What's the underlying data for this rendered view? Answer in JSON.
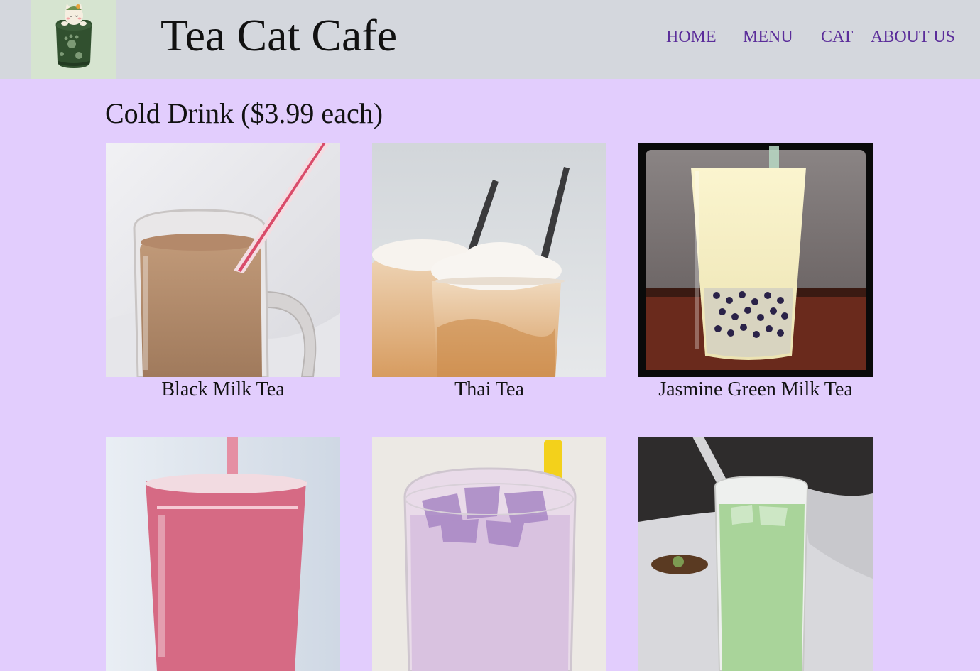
{
  "site": {
    "title": "Tea Cat Cafe",
    "logo_icon": "cat-in-tea-cup-icon"
  },
  "nav": {
    "items": [
      {
        "label": "HOME"
      },
      {
        "label": "MENU"
      },
      {
        "label": "CAT"
      },
      {
        "label": "ABOUT US"
      }
    ]
  },
  "colors": {
    "page_background": "#e2cdfd",
    "header_background": "#d4d7dd",
    "nav_link": "#5b2d9a"
  },
  "section": {
    "title": "Cold Drink ($3.99 each)"
  },
  "drinks": [
    {
      "name": "Black Milk Tea",
      "image": "black-milk-tea-photo"
    },
    {
      "name": "Thai Tea",
      "image": "thai-tea-photo"
    },
    {
      "name": "Jasmine Green Milk Tea",
      "image": "jasmine-green-milk-tea-photo"
    },
    {
      "name": "",
      "image": "strawberry-drink-photo"
    },
    {
      "name": "",
      "image": "taro-milk-tea-photo"
    },
    {
      "name": "",
      "image": "matcha-milk-tea-photo"
    }
  ]
}
